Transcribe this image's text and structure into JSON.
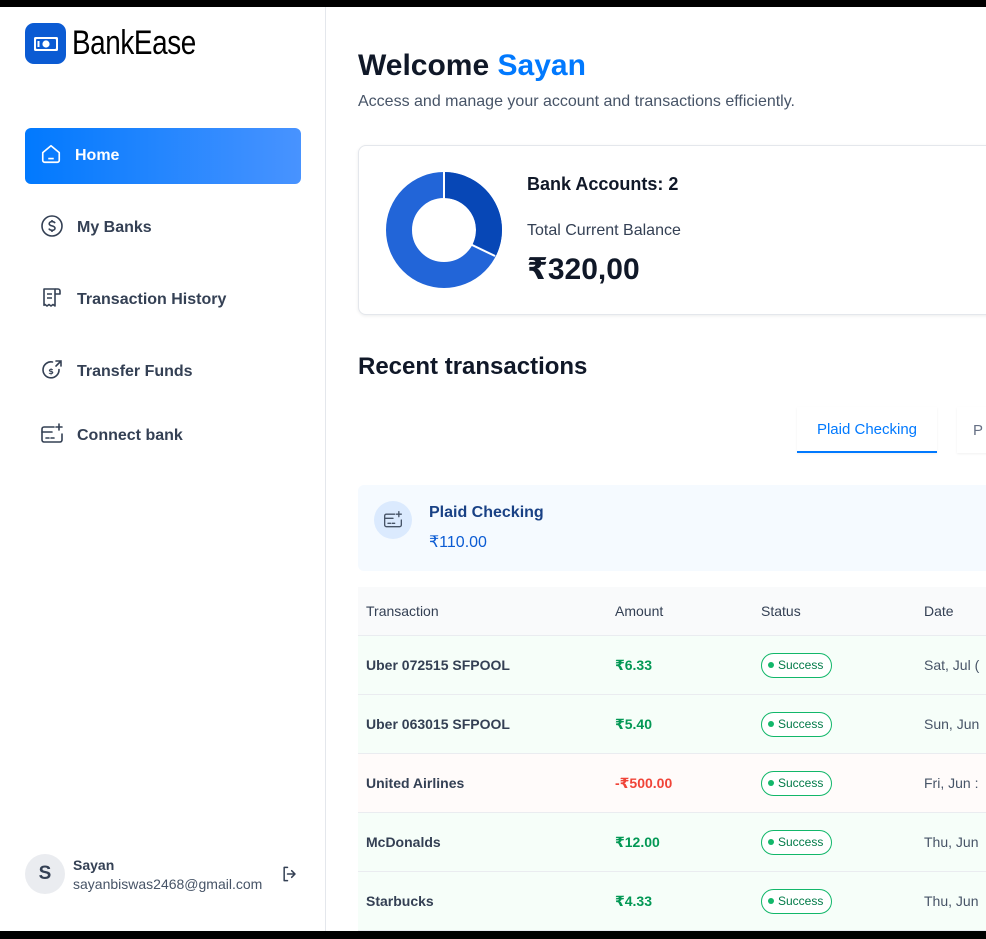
{
  "brand": {
    "name": "BankEase",
    "icon": "banknote-icon",
    "color": "#0b5bd3"
  },
  "sidebar": {
    "items": [
      {
        "label": "Home",
        "icon": "home-icon",
        "active": true
      },
      {
        "label": "My Banks",
        "icon": "dollar-circle-icon",
        "active": false
      },
      {
        "label": "Transaction History",
        "icon": "receipt-icon",
        "active": false
      },
      {
        "label": "Transfer Funds",
        "icon": "money-send-icon",
        "active": false
      },
      {
        "label": "Connect bank",
        "icon": "card-add-icon",
        "active": false
      }
    ],
    "user": {
      "initial": "S",
      "name": "Sayan",
      "email": "sayanbiswas2468@gmail.com",
      "logout_icon": "logout-icon"
    }
  },
  "header": {
    "greeting": "Welcome",
    "user_name": "Sayan",
    "subtitle": "Access and manage your account and transactions efficiently."
  },
  "balance": {
    "bank_accounts_label": "Bank Accounts: 2",
    "total_label": "Total Current Balance",
    "total_value": "₹320,00",
    "donut_colors": [
      "#0747b6",
      "#2265d8"
    ]
  },
  "recent": {
    "title": "Recent transactions",
    "tabs": [
      {
        "label": "Plaid Checking",
        "active": true
      },
      {
        "label": "P",
        "active": false
      }
    ],
    "bank": {
      "name": "Plaid Checking",
      "balance": "₹110.00",
      "icon": "card-add-icon"
    },
    "columns": [
      "Transaction",
      "Amount",
      "Status",
      "Date"
    ],
    "rows": [
      {
        "name": "Uber 072515 SFPOOL",
        "amount": "₹6.33",
        "type": "pos",
        "status": "Success",
        "date": "Sat, Jul ("
      },
      {
        "name": "Uber 063015 SFPOOL",
        "amount": "₹5.40",
        "type": "pos",
        "status": "Success",
        "date": "Sun, Jun"
      },
      {
        "name": "United Airlines",
        "amount": "-₹500.00",
        "type": "neg",
        "status": "Success",
        "date": "Fri, Jun :"
      },
      {
        "name": "McDonalds",
        "amount": "₹12.00",
        "type": "pos",
        "status": "Success",
        "date": "Thu, Jun"
      },
      {
        "name": "Starbucks",
        "amount": "₹4.33",
        "type": "pos",
        "status": "Success",
        "date": "Thu, Jun"
      }
    ]
  },
  "colors": {
    "accent": "#0179fe",
    "success": "#12b76a",
    "danger": "#f04438"
  }
}
